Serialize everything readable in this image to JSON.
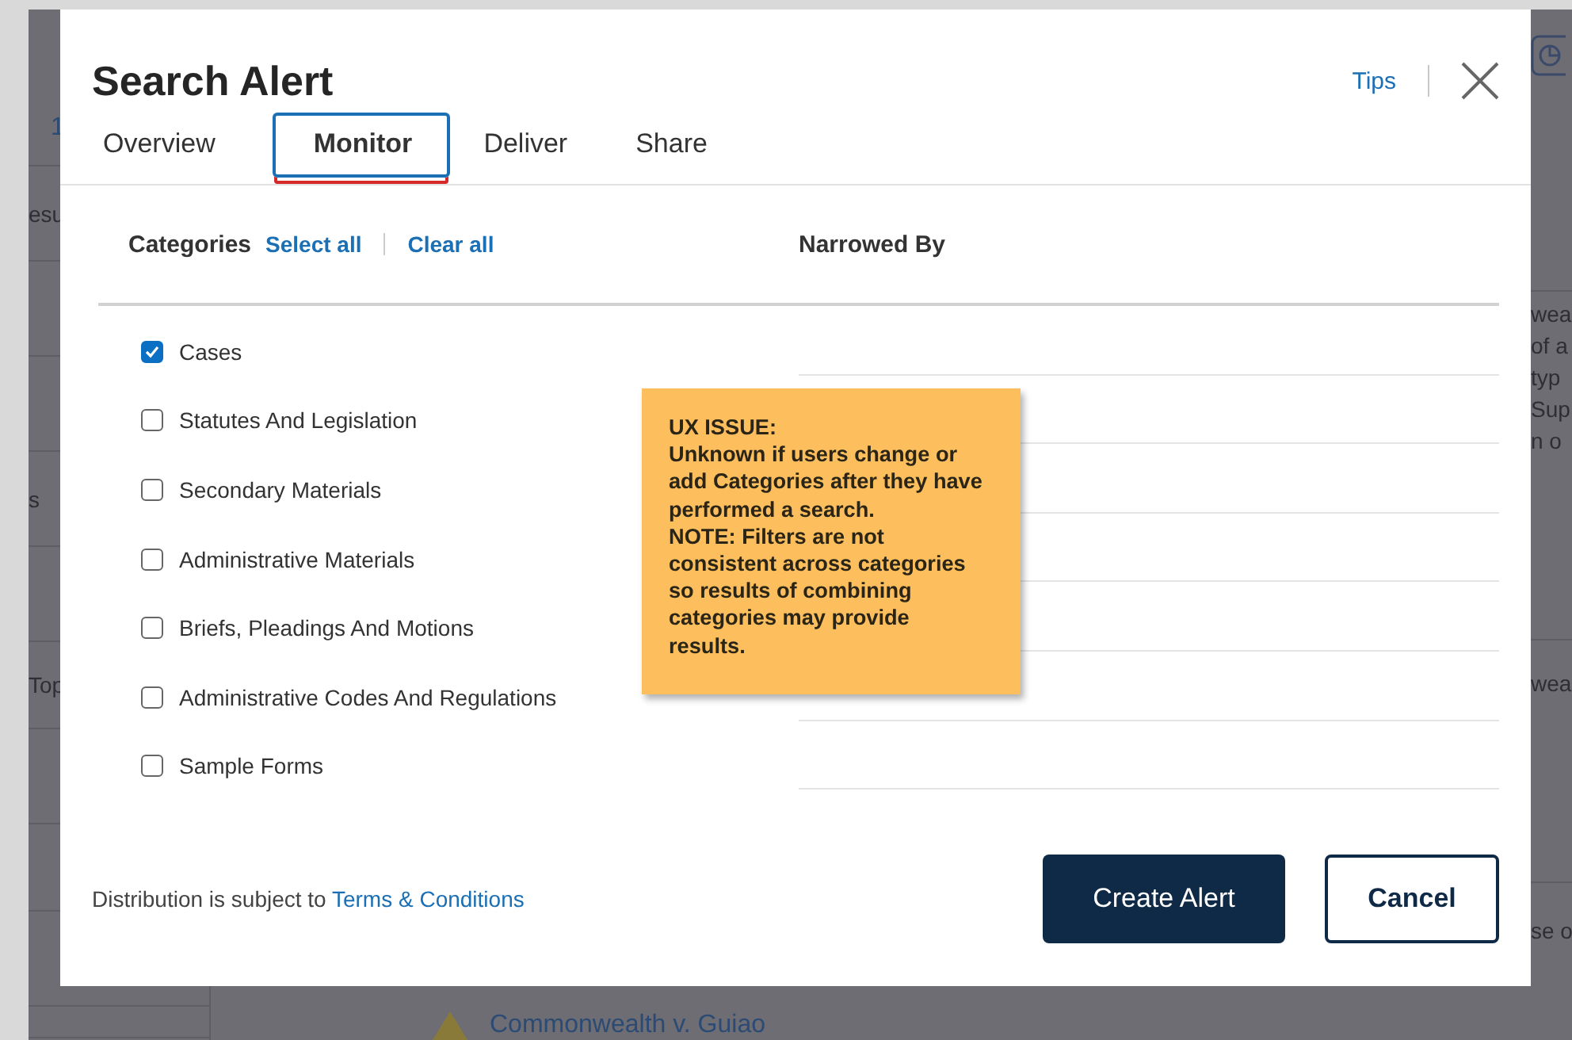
{
  "background": {
    "left_fragments": [
      "1",
      "esu",
      "s",
      "Top"
    ],
    "right_fragments": [
      "wea",
      "of a",
      "typ",
      "Sup",
      "n o",
      "wea",
      "se o"
    ],
    "result_link": "Commonwealth v. Guiao"
  },
  "dialog": {
    "title": "Search Alert",
    "tips_link": "Tips",
    "tabs": [
      {
        "label": "Overview",
        "selected": false
      },
      {
        "label": "Monitor",
        "selected": true
      },
      {
        "label": "Deliver",
        "selected": false
      },
      {
        "label": "Share",
        "selected": false
      }
    ],
    "categories": {
      "label": "Categories",
      "select_all": "Select all",
      "clear_all": "Clear all",
      "items": [
        {
          "label": "Cases",
          "checked": true
        },
        {
          "label": "Statutes And Legislation",
          "checked": false
        },
        {
          "label": "Secondary Materials",
          "checked": false
        },
        {
          "label": "Administrative Materials",
          "checked": false
        },
        {
          "label": "Briefs, Pleadings And Motions",
          "checked": false
        },
        {
          "label": "Administrative Codes And Regulations",
          "checked": false
        },
        {
          "label": "Sample Forms",
          "checked": false
        }
      ]
    },
    "narrowed_by": {
      "label": "Narrowed By"
    },
    "note": {
      "lines": [
        "UX ISSUE:",
        "Unknown if users change or add Categories after they have performed a search.",
        "NOTE: Filters are not consistent across categories so results of combining categories may provide results."
      ]
    },
    "footer": {
      "text": "Distribution is subject to",
      "link": "Terms & Conditions"
    },
    "buttons": [
      {
        "label": "Create Alert",
        "kind": "primary"
      },
      {
        "label": "Cancel",
        "kind": "secondary"
      }
    ]
  }
}
